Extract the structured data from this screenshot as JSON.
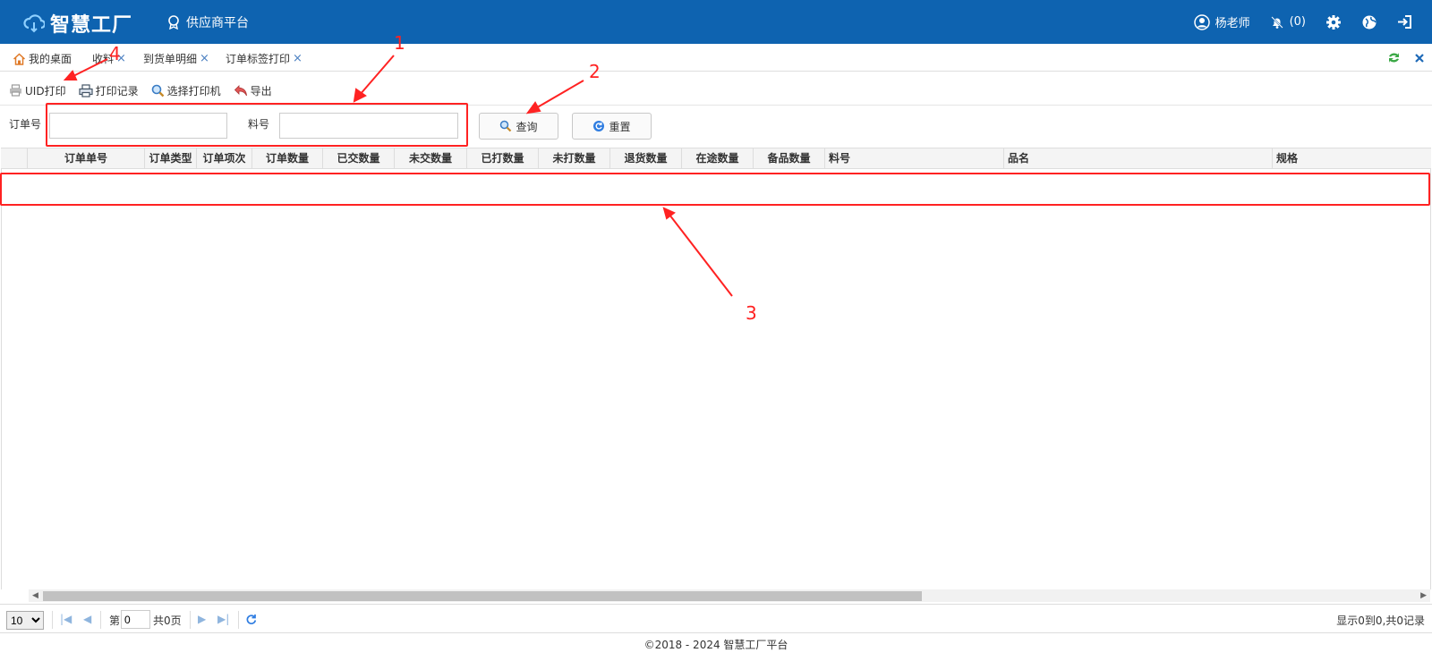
{
  "header": {
    "title": "智慧工厂",
    "platform": "供应商平台",
    "user": "杨老师",
    "notifications": "(0)",
    "brand_color": "#0e63b0"
  },
  "tabs": [
    {
      "label": "我的桌面",
      "closable": false
    },
    {
      "label": "收料",
      "closable": true
    },
    {
      "label": "到货单明细",
      "closable": true
    },
    {
      "label": "订单标签打印",
      "closable": true
    }
  ],
  "tab_close_symbol": "×",
  "toolbar": {
    "uid_print": "UID打印",
    "print_records": "打印记录",
    "select_printer": "选择打印机",
    "export": "导出"
  },
  "search": {
    "order_no_label": "订单号",
    "order_no_value": "",
    "part_no_label": "料号",
    "part_no_value": "",
    "query_button": "查询",
    "reset_button": "重置"
  },
  "table": {
    "columns": [
      "订单单号",
      "订单类型",
      "订单项次",
      "订单数量",
      "已交数量",
      "未交数量",
      "已打数量",
      "未打数量",
      "退货数量",
      "在途数量",
      "备品数量",
      "料号",
      "品名",
      "规格"
    ],
    "rows": []
  },
  "pager": {
    "page_size": "10",
    "page_size_options": [
      "10"
    ],
    "page_prefix": "第",
    "page_value": "0",
    "total_pages": "共0页",
    "info": "显示0到0,共0记录"
  },
  "footer": "©2018 - 2024 智慧工厂平台",
  "annotations": [
    "1",
    "2",
    "3",
    "4"
  ],
  "annotation_color": "#ff2222"
}
